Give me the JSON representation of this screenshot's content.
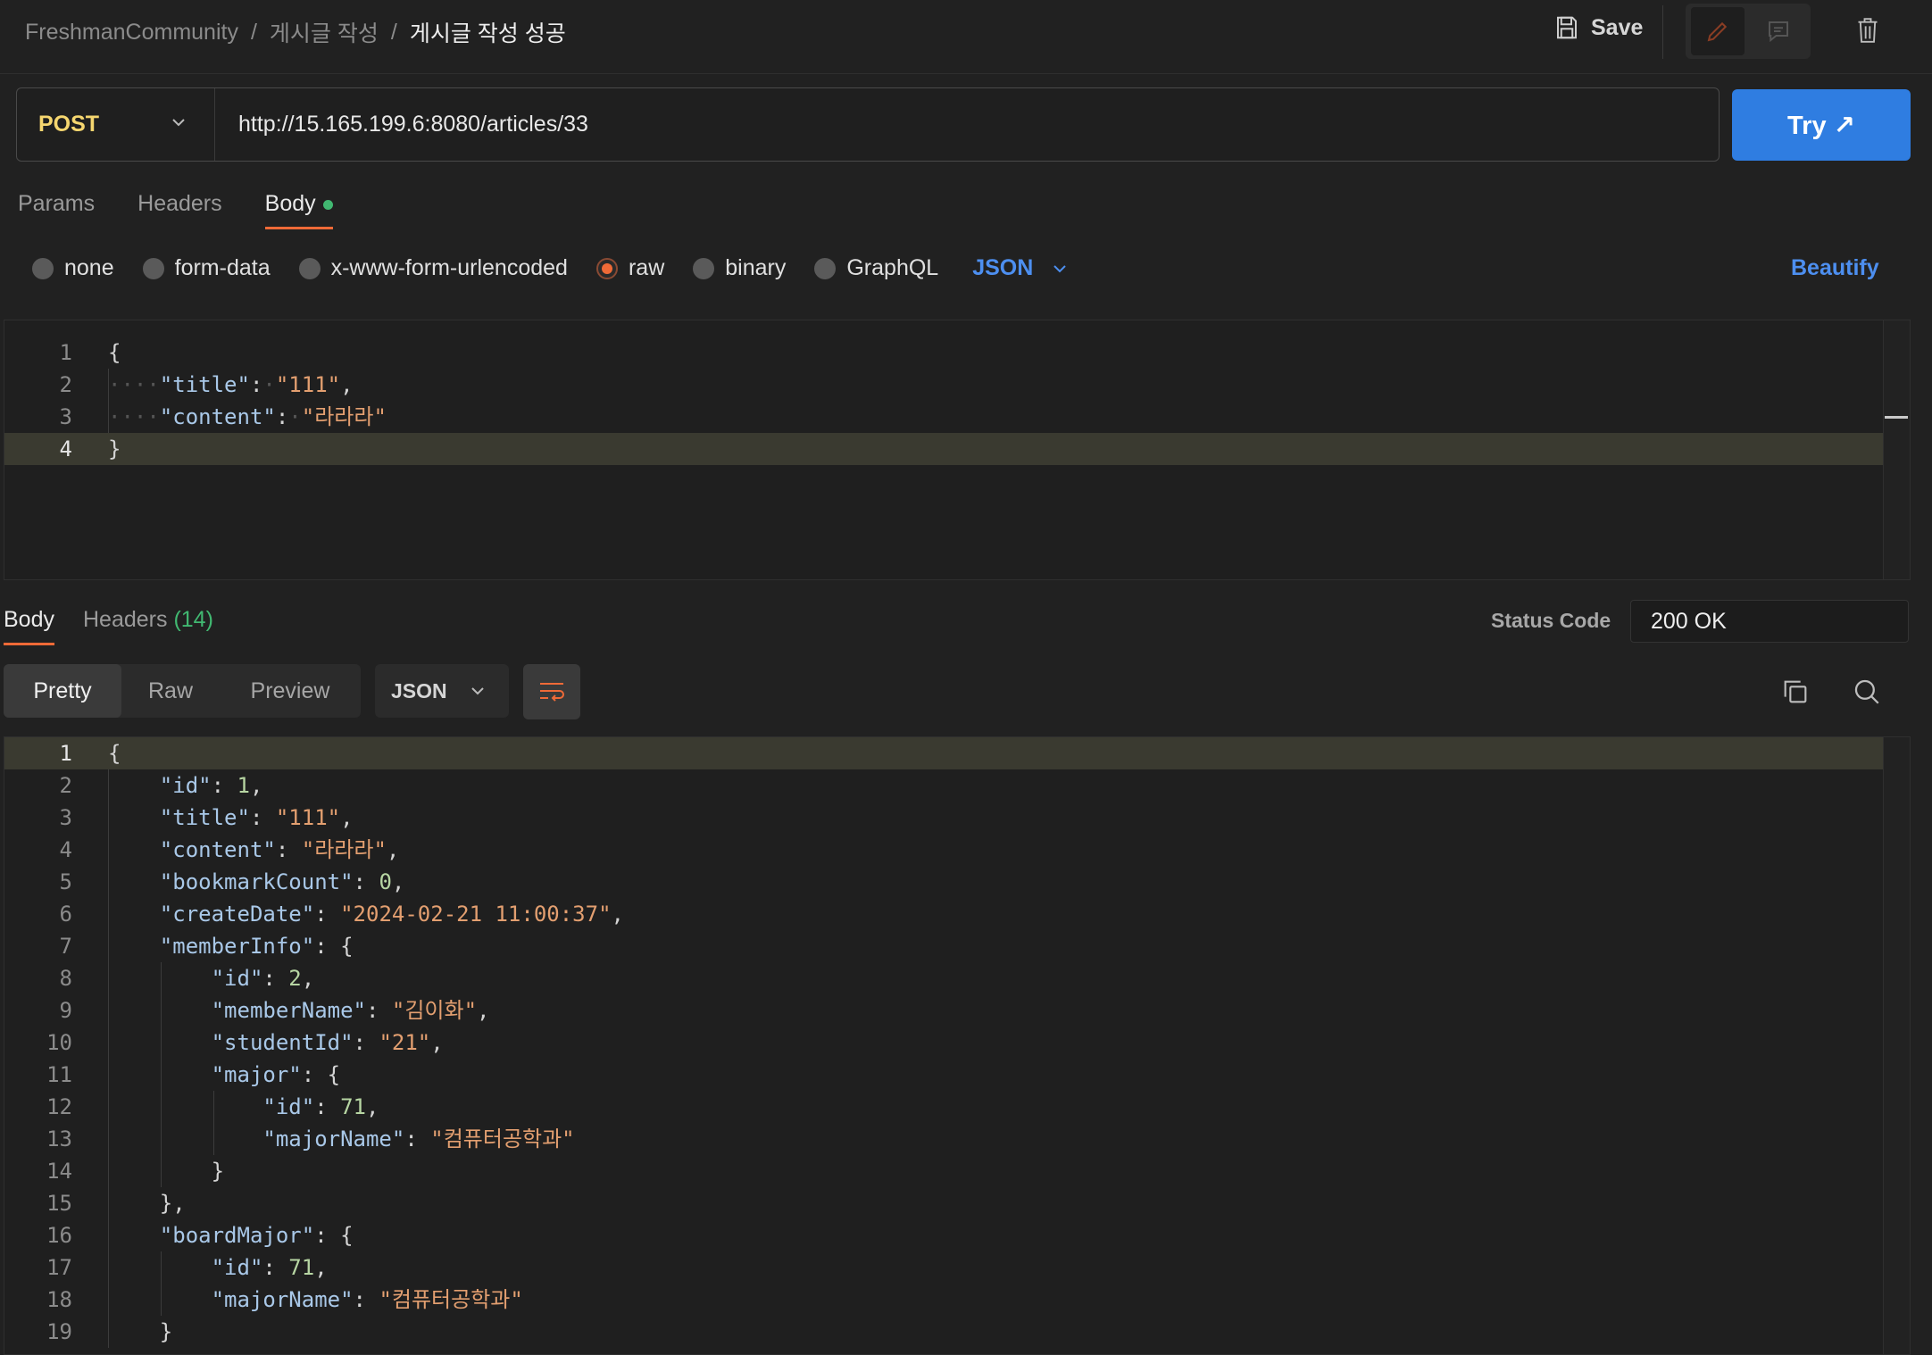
{
  "breadcrumb": [
    "FreshmanCommunity",
    "게시글 작성",
    "게시글 작성 성공"
  ],
  "header": {
    "save_label": "Save"
  },
  "request": {
    "method": "POST",
    "url": "http://15.165.199.6:8080/articles/33",
    "try_label": "Try ↗",
    "tabs": [
      "Params",
      "Headers",
      "Body"
    ],
    "body_types": [
      "none",
      "form-data",
      "x-www-form-urlencoded",
      "raw",
      "binary",
      "GraphQL"
    ],
    "selected_body_type": "raw",
    "format": "JSON",
    "beautify_label": "Beautify",
    "body_lines": [
      "1",
      "2",
      "3",
      "4"
    ]
  },
  "response": {
    "tab_body": "Body",
    "tab_headers": "Headers",
    "headers_count": "(14)",
    "status_label": "Status Code",
    "status_value": "200 OK",
    "views": [
      "Pretty",
      "Raw",
      "Preview"
    ],
    "format": "JSON"
  },
  "colors": {
    "accent": "#ef6a37",
    "primary": "#2f7de1",
    "method": "#f5d66f",
    "dot": "#41b871"
  }
}
